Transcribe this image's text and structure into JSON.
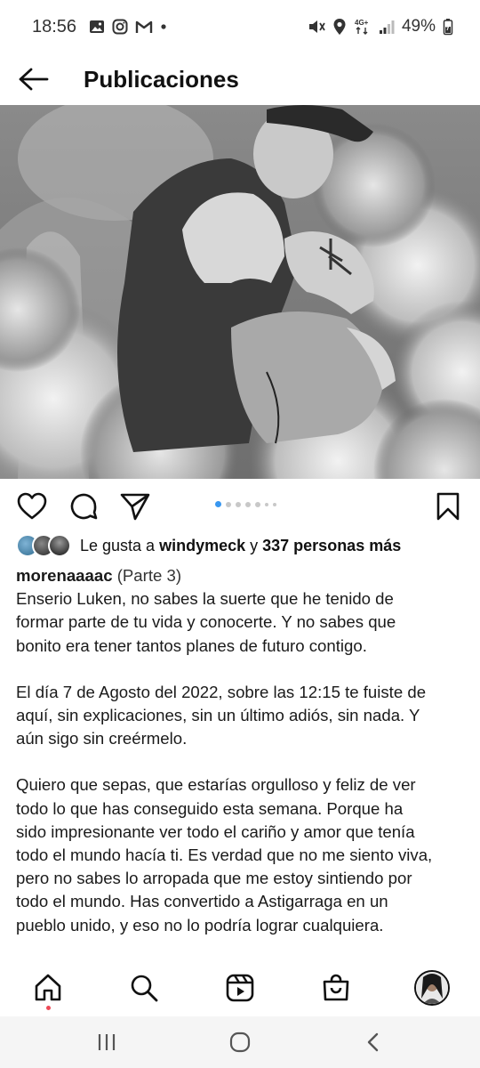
{
  "status_bar": {
    "time": "18:56",
    "left_icons": [
      "gallery-icon",
      "instagram-icon",
      "gmail-icon",
      "dot-icon"
    ],
    "right_icons": [
      "mute-icon",
      "location-icon",
      "network-4g-icon",
      "signal-icon",
      "battery-icon"
    ],
    "network_label_top": "4G+",
    "battery": "49%"
  },
  "header": {
    "title": "Publicaciones"
  },
  "post": {
    "image_icon": "post-photo",
    "carousel": {
      "count": 7,
      "active_index": 0
    }
  },
  "likes": {
    "prefix": "Le gusta a ",
    "user": "windymeck",
    "middle": " y ",
    "others": "337 personas más"
  },
  "caption": {
    "username": "morenaaaac",
    "part": "(Parte 3)",
    "paragraphs": [
      [
        "Enserio Luken, no sabes la suerte que he tenido de",
        "formar parte de tu vida y conocerte. Y no sabes que",
        "bonito era tener tantos planes de futuro contigo."
      ],
      [
        "El día 7 de Agosto del 2022, sobre las 12:15 te fuiste de",
        "aquí, sin explicaciones, sin un último adiós, sin nada. Y",
        "aún sigo sin creérmelo."
      ],
      [
        "Quiero que sepas, que estarías orgulloso y feliz de ver",
        "todo lo que has conseguido esta semana. Porque ha",
        "sido impresionante ver todo el cariño y amor que tenía",
        "todo el mundo hacía ti. Es verdad que no me siento viva,",
        "pero no sabes lo arropada que me estoy sintiendo por",
        "todo el mundo. Has convertido a Astigarraga en un",
        "pueblo unido, y eso no lo podría lograr cualquiera."
      ]
    ]
  },
  "bottom_nav": {
    "items": [
      "home-icon",
      "search-icon",
      "reels-icon",
      "shop-icon",
      "profile-avatar"
    ],
    "active": "home-icon"
  },
  "colors": {
    "accent": "#3897f0",
    "notification": "#ed4956",
    "text": "#111111"
  }
}
